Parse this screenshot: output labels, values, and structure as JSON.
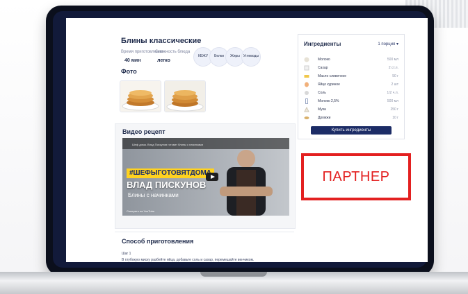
{
  "recipe": {
    "title": "Блины классические",
    "meta": [
      {
        "label": "Время приготовления",
        "value": "40 мин"
      },
      {
        "label": "Сложность блюда",
        "value": "легко"
      }
    ],
    "nutrition": [
      "КБЖУ",
      "Белки",
      "Жиры",
      "Углеводы"
    ],
    "photo_label": "Фото",
    "video_label": "Видео рецепт",
    "method_label": "Способ приготовления",
    "steps": [
      "Шаг 1",
      "В глубокую миску разбейте яйца, добавьте соль и сахар, перемешайте венчиком."
    ]
  },
  "ingredients": {
    "title": "Ингредиенты",
    "portions": "1 порция",
    "items": [
      {
        "name": "Молоко",
        "amount": "500 мл"
      },
      {
        "name": "Сахар",
        "amount": "2 ст.л."
      },
      {
        "name": "Масло сливочное",
        "amount": "50 г"
      },
      {
        "name": "Яйцо куриное",
        "amount": "2 шт"
      },
      {
        "name": "Соль",
        "amount": "1/2 ч.л."
      },
      {
        "name": "Молоко 2,5%",
        "amount": "500 мл"
      },
      {
        "name": "Мука",
        "amount": "250 г"
      },
      {
        "name": "Дрожжи",
        "amount": "10 г"
      }
    ],
    "buy_label": "Купить ингредиенты"
  },
  "video": {
    "subtitle": "Шеф дома. Влад Пискунов готовит блины с начинками",
    "hashtag": "#ШЕФЫГОТОВЯТДОМА",
    "name": "ВЛАД ПИСКУНОВ",
    "description": "Блины с начинками",
    "footer": "Смотреть на YouTube"
  },
  "partner": {
    "label": "ПАРТНЕР"
  },
  "colors": {
    "brand": "#1c2c66",
    "partner": "#e32020",
    "hashtag": "#ffd21f"
  }
}
